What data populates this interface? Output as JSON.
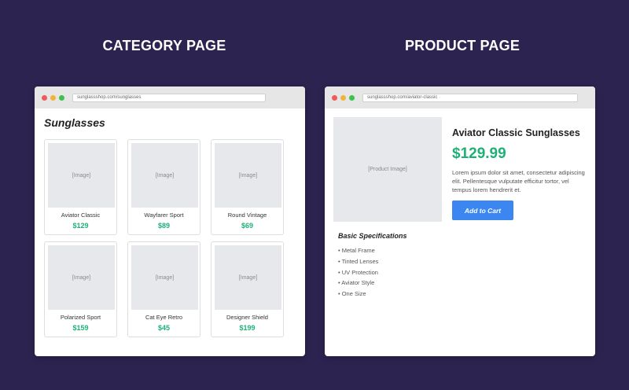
{
  "category_section": {
    "title": "CATEGORY PAGE",
    "url": "sunglassshop.com/sunglasses",
    "heading": "Sunglasses",
    "products": [
      {
        "image": "[Image]",
        "name": "Aviator Classic",
        "price": "$129"
      },
      {
        "image": "[Image]",
        "name": "Wayfarer Sport",
        "price": "$89"
      },
      {
        "image": "[Image]",
        "name": "Round Vintage",
        "price": "$69"
      },
      {
        "image": "[Image]",
        "name": "Polarized Sport",
        "price": "$159"
      },
      {
        "image": "[Image]",
        "name": "Cat Eye Retro",
        "price": "$45"
      },
      {
        "image": "[Image]",
        "name": "Designer Shield",
        "price": "$199"
      }
    ]
  },
  "product_section": {
    "title": "PRODUCT PAGE",
    "url": "sunglassshop.com/aviator-classic",
    "image": "[Product Image]",
    "name": "Aviator Classic Sunglasses",
    "price": "$129.99",
    "description": "Lorem ipsum dolor sit amet, consectetur adipiscing elit. Pellentesque vulputate efficitur tortor, vel tempus lorem hendrerit et.",
    "add_to_cart": "Add to Cart",
    "specs_title": "Basic Specifications",
    "specs": [
      "• Metal Frame",
      "• Tinted Lenses",
      "• UV Protection",
      "• Aviator Style",
      "• One Size"
    ]
  },
  "colors": {
    "background": "#2c2350",
    "price_green": "#1fb077",
    "button_blue": "#3b86f0"
  }
}
